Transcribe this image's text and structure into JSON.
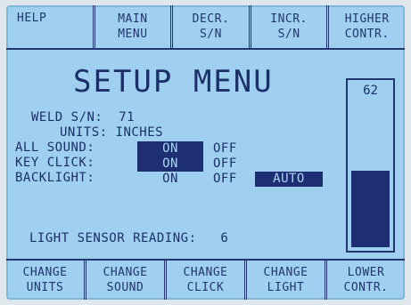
{
  "top_softkeys": [
    {
      "line1": "HELP",
      "line2": ""
    },
    {
      "line1": "MAIN",
      "line2": "MENU"
    },
    {
      "line1": "DECR.",
      "line2": "S/N"
    },
    {
      "line1": "INCR.",
      "line2": "S/N"
    },
    {
      "line1": "HIGHER",
      "line2": "CONTR."
    }
  ],
  "bottom_softkeys": [
    {
      "line1": "CHANGE",
      "line2": "UNITS"
    },
    {
      "line1": "CHANGE",
      "line2": "SOUND"
    },
    {
      "line1": "CHANGE",
      "line2": "CLICK"
    },
    {
      "line1": "CHANGE",
      "line2": "LIGHT"
    },
    {
      "line1": "LOWER",
      "line2": "CONTR."
    }
  ],
  "title": "SETUP MENU",
  "weld_sn": {
    "label": "WELD S/N:",
    "value": "71"
  },
  "units": {
    "label": "UNITS:",
    "value": "INCHES"
  },
  "all_sound": {
    "label": "ALL SOUND:",
    "on": "ON",
    "off": "OFF",
    "selected": "ON"
  },
  "key_click": {
    "label": "KEY CLICK:",
    "on": "ON",
    "off": "OFF",
    "selected": "ON"
  },
  "backlight": {
    "label": "BACKLIGHT:",
    "on": "ON",
    "off": "OFF",
    "auto": "AUTO",
    "selected": "AUTO"
  },
  "light_sensor": {
    "label": "LIGHT SENSOR READING:",
    "value": "6"
  },
  "contrast": {
    "value": "62",
    "fill_fraction": 0.47
  },
  "colors": {
    "screen": "#9fd0ef",
    "ink": "#1c2f6a",
    "highlight": "#1d2e73"
  }
}
